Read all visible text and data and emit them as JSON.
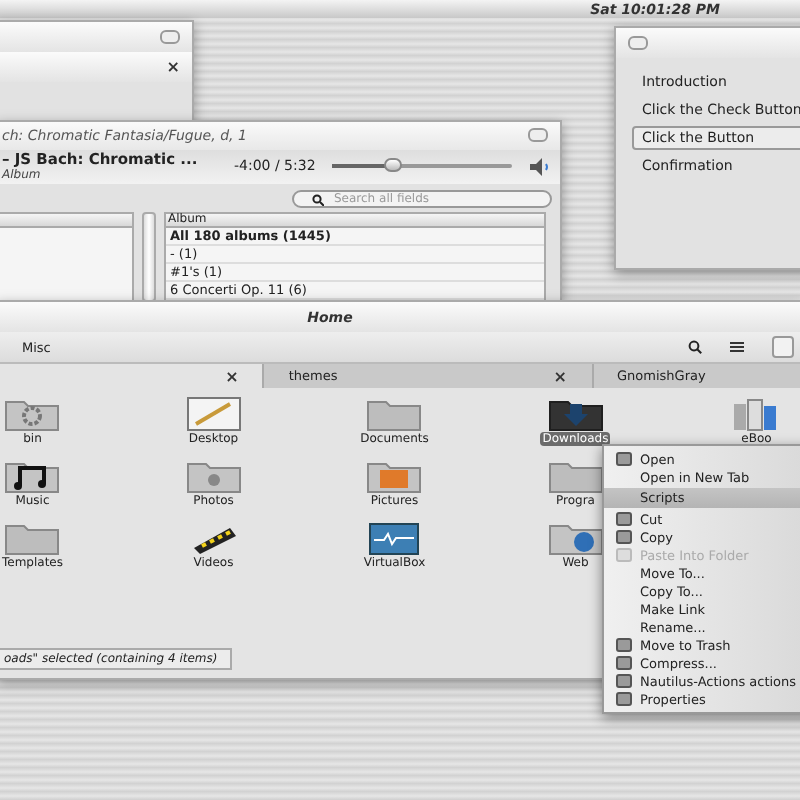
{
  "panel": {
    "clock": "Sat 10:01:28 PM"
  },
  "back_window": {
    "close": "×"
  },
  "wizard": {
    "steps": [
      {
        "label": "Introduction",
        "selected": false
      },
      {
        "label": "Click the Check Button",
        "selected": false
      },
      {
        "label": "Click the Button",
        "selected": true
      },
      {
        "label": "Confirmation",
        "selected": false
      }
    ]
  },
  "music_player": {
    "title": "ch: Chromatic Fantasia/Fugue, d, 1",
    "track": "– JS Bach: Chromatic ...",
    "album": "Album",
    "time": "-4:00 / 5:32",
    "position": {
      "level": 0.33
    },
    "search": {
      "placeholder": "Search all fields"
    },
    "album_column": "Album",
    "albums": [
      {
        "kind": "all",
        "label": "All 180 albums (1445)"
      },
      {
        "kind": "album",
        "label": "- (1)"
      },
      {
        "kind": "album",
        "label": "#1's (1)"
      },
      {
        "kind": "album",
        "label": "6 Concerti Op. 11 (6)"
      }
    ]
  },
  "file_manager": {
    "title": "Home",
    "location": "Misc",
    "tabs": [
      {
        "selected": true,
        "close": "×"
      },
      {
        "label": "themes",
        "selected": false,
        "close": "×"
      },
      {
        "label": "GnomishGray",
        "selected": false
      }
    ],
    "rows": [
      [
        {
          "kind": "gear",
          "label": "bin",
          "selected": false
        },
        {
          "kind": "pencil",
          "label": "Desktop",
          "selected": false
        },
        {
          "kind": "folder",
          "label": "Documents",
          "selected": false
        },
        {
          "kind": "download",
          "label": "Downloads",
          "selected": true
        },
        {
          "kind": "books",
          "label": "eBoo",
          "selected": false
        }
      ],
      [
        {
          "kind": "music",
          "label": "Music",
          "selected": false
        },
        {
          "kind": "camera",
          "label": "Photos",
          "selected": false
        },
        {
          "kind": "picture",
          "label": "Pictures",
          "selected": false
        },
        {
          "kind": "folder",
          "label": "Progra",
          "selected": false
        }
      ],
      [
        {
          "kind": "folder",
          "label": "Templates",
          "selected": false
        },
        {
          "kind": "film",
          "label": "Videos",
          "selected": false
        },
        {
          "kind": "monitor",
          "label": "VirtualBox",
          "selected": false
        },
        {
          "kind": "globe",
          "label": "Web",
          "selected": false
        }
      ]
    ],
    "status": "oads\" selected  (containing 4 items)"
  },
  "context_menu": {
    "items": [
      {
        "kind": "icon",
        "label": "Open",
        "disabled": false
      },
      {
        "kind": "plain",
        "label": "Open in New Tab",
        "disabled": false
      },
      {
        "kind": "header",
        "label": "Scripts",
        "disabled": false
      },
      {
        "kind": "icon",
        "label": "Cut",
        "disabled": false
      },
      {
        "kind": "icon",
        "label": "Copy",
        "disabled": false
      },
      {
        "kind": "icon",
        "label": "Paste Into Folder",
        "disabled": true
      },
      {
        "kind": "plain",
        "label": "Move To...",
        "disabled": false
      },
      {
        "kind": "plain",
        "label": "Copy To...",
        "disabled": false
      },
      {
        "kind": "plain",
        "label": "Make Link",
        "disabled": false
      },
      {
        "kind": "plain",
        "label": "Rename...",
        "disabled": false
      },
      {
        "kind": "icon",
        "label": "Move to Trash",
        "disabled": false
      },
      {
        "kind": "icon",
        "label": "Compress...",
        "disabled": false
      },
      {
        "kind": "icon",
        "label": "Nautilus-Actions actions",
        "disabled": false
      },
      {
        "kind": "icon",
        "label": "Properties",
        "disabled": false
      }
    ]
  }
}
